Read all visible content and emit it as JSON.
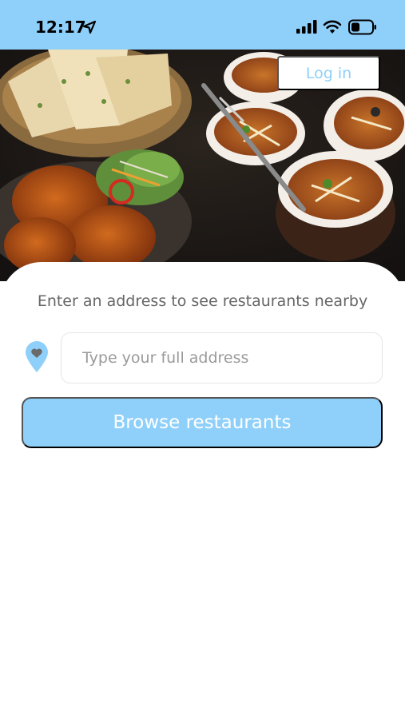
{
  "status_bar": {
    "time": "12:17",
    "icons": [
      "location-arrow-icon",
      "cellular-signal-icon",
      "wifi-icon",
      "battery-icon"
    ]
  },
  "header": {
    "login_label": "Log in"
  },
  "address_section": {
    "prompt": "Enter an address to see restaurants nearby",
    "address_placeholder": "Type your full address",
    "address_value": "",
    "pin_icon": "location-pin-heart-icon",
    "browse_label": "Browse restaurants"
  },
  "colors": {
    "accent": "#8fd0fa",
    "prompt_text": "#666666",
    "placeholder_text": "#9a9a9a",
    "pin": "#8fd0fa"
  }
}
